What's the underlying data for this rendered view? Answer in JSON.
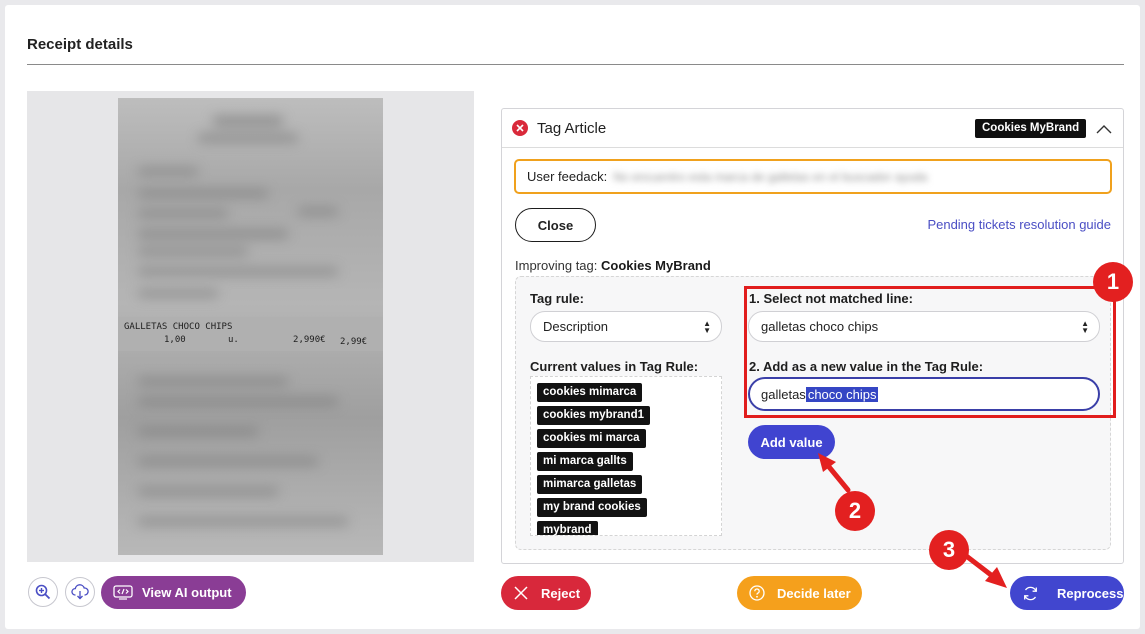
{
  "page": {
    "title": "Receipt details"
  },
  "receipt": {
    "line_text": "GALLETAS CHOCO CHIPS",
    "qty": "1,00",
    "unit": "u.",
    "unit_price": "2,990€",
    "total": "2,99€"
  },
  "viewer_toolbar": {
    "zoom_icon": "zoom-in-icon",
    "download_icon": "cloud-download-icon",
    "ai_output_label": "View AI output"
  },
  "tag_panel": {
    "title": "Tag Article",
    "brand_badge": "Cookies MyBrand",
    "feedback_label": "User feedack:",
    "feedback_value": "No encuentro esta marca de galletas en el buscador ayuda",
    "close_label": "Close",
    "guide_link": "Pending tickets resolution guide",
    "improving_prefix": "Improving tag:",
    "improving_tag": "Cookies MyBrand",
    "tag_rule_label": "Tag rule:",
    "tag_rule_value": "Description",
    "current_values_label": "Current values in Tag Rule:",
    "current_values": [
      "cookies mimarca",
      "cookies mybrand1",
      "cookies mi marca",
      "mi marca gallts",
      "mimarca galletas",
      "my brand cookies",
      "mybrand"
    ],
    "step1_label": "1. Select not matched line:",
    "step1_value": "galletas choco chips",
    "step2_label": "2. Add as a new value in the Tag Rule:",
    "input_prefix": "galletas",
    "input_selected": "choco chips",
    "add_value_label": "Add value"
  },
  "actions": {
    "reject_label": "Reject",
    "decide_later_label": "Decide later",
    "reprocess_label": "Reprocess"
  },
  "annotations": {
    "step1": "1",
    "step2": "2",
    "step3": "3"
  },
  "colors": {
    "accent": "#4146cf",
    "danger": "#d8283b",
    "warning": "#f5a01c",
    "ai_purple": "#8a3d95",
    "annotation_red": "#e32020"
  }
}
